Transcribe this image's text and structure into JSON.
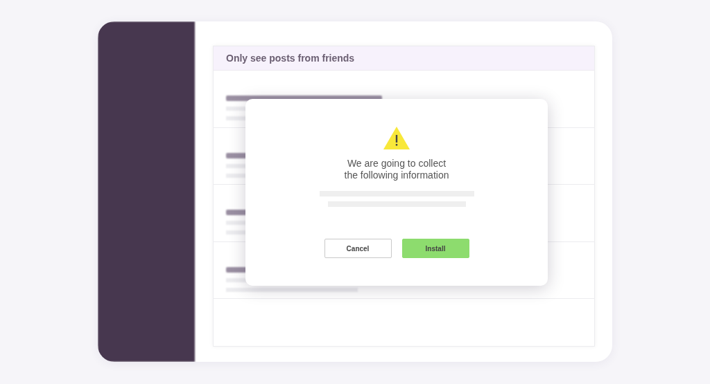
{
  "panel": {
    "header": "Only see posts from friends"
  },
  "dialog": {
    "message": "We are going to collect\nthe following information",
    "buttons": [
      {
        "label": "Cancel",
        "kind": "secondary"
      },
      {
        "label": "Install",
        "kind": "primary"
      }
    ]
  }
}
